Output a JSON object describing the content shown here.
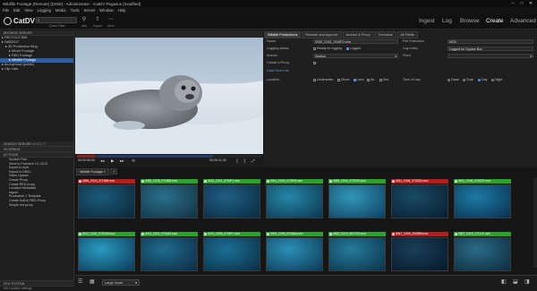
{
  "window": {
    "title": "Wildlife Footage (Remote) [D455] - Administrator - CatDV Pegasus (modified)"
  },
  "menu": [
    "File",
    "Edit",
    "View",
    "Logging",
    "Media",
    "Tools",
    "Server",
    "Window",
    "Help"
  ],
  "header": {
    "logo": "CatDV",
    "search_label": "Quick Filter",
    "toolbar": [
      {
        "icon": "filter-icon",
        "label": "Add"
      },
      {
        "icon": "export-icon",
        "label": "Export"
      },
      {
        "icon": "more-icon",
        "label": "More"
      }
    ],
    "nav": [
      "Ingest",
      "Log",
      "Browse",
      "Create",
      "Advanced"
    ],
    "active_nav": "Create"
  },
  "left": {
    "browse_header": "BROWSE SERVER",
    "tree": [
      {
        "label": "RECYCLE BIN",
        "indent": 2
      },
      {
        "label": "NAB2017",
        "indent": 2
      },
      {
        "label": "3D Production Blog",
        "indent": 6
      },
      {
        "label": "Mixed Footage",
        "indent": 10
      },
      {
        "label": "RED Footage",
        "indent": 10
      },
      {
        "label": "Wildlife Footage",
        "indent": 10,
        "selected": true
      },
      {
        "label": "Anonymous (public)",
        "indent": 2
      },
      {
        "label": "Clip Lists",
        "indent": 2
      }
    ],
    "search_header": "SEARCH SERVER",
    "search_value": "NAB2017",
    "filter_header": "FILTERING",
    "actions_header": "ACTIONS",
    "actions": [
      "Scratch Pad",
      "Send to Premiere CC 2019",
      "Export to Avid",
      "Export to DBXL",
      "Video Upload",
      "Create Proxy",
      "Create RED proxy",
      "Location Metadata",
      "Ingest",
      "Production 1 Template",
      "Create built-in RED Proxy",
      "Simple red proxy"
    ],
    "filesystem_header": "FILE SYSTEM",
    "filesystem_item": "Net Locaiton settings"
  },
  "viewer": {
    "timecode_left": "00:00:00:00",
    "timecode_right": "00:00:11:05",
    "progress": 0.1
  },
  "metadata": {
    "tabs": [
      "Wildlife Productions",
      "Release and Approve",
      "Archive & Proxy",
      "Technical",
      "All Fields"
    ],
    "active_tab": "Wildlife Productions",
    "name_label": "Name",
    "name_value": "2006_C041_0119F2.mov",
    "logging_label": "Logging status",
    "logging_opts": [
      {
        "label": "Ready for logging",
        "on": false
      },
      {
        "label": "Logged",
        "on": true
      }
    ],
    "animal_label": "Animal",
    "animal_value": "Sealion",
    "create_proxy_label": "Create a Proxy",
    "date_link": "Date/Time Info",
    "file_ext_label": "File Extension",
    "file_ext_value": "MOV",
    "log_notes_label": "Log notes",
    "log_notes_value": "Logged for Square Box",
    "plant_label": "Plant",
    "location_label": "Location",
    "location_opts": [
      {
        "label": "Underwater",
        "on": false
      },
      {
        "label": "Shore",
        "on": false
      },
      {
        "label": "Land",
        "on": true
      },
      {
        "label": "Air",
        "on": false
      },
      {
        "label": "Sea",
        "on": false
      }
    ],
    "tod_label": "Time of day",
    "tod_opts": [
      {
        "label": "Dawn",
        "on": false
      },
      {
        "label": "Dusk",
        "on": false
      },
      {
        "label": "Day",
        "on": true
      },
      {
        "label": "Night",
        "on": false
      }
    ]
  },
  "gallery": {
    "tab": "Wildlife Footage",
    "tiles": [
      {
        "name": "4056_C024_0713B5.mov",
        "status": "red",
        "c1": "#1b5a7a",
        "c2": "#0b2538"
      },
      {
        "name": "4058_C026_0713B8.mov",
        "status": "green",
        "c1": "#2a6f8a",
        "c2": "#123244"
      },
      {
        "name": "4010_C021_0720F1.mov",
        "status": "green",
        "c1": "#1f5e84",
        "c2": "#0a2a40"
      },
      {
        "name": "4041_C004_0720F8.mov",
        "status": "green",
        "c1": "#2587a8",
        "c2": "#0c3650"
      },
      {
        "name": "4058_C004_0707DE.mov",
        "status": "green",
        "c1": "#3296b8",
        "c2": "#0e4060"
      },
      {
        "name": "4011_C048_0720DD.mov",
        "status": "red",
        "c1": "#1a4a66",
        "c2": "#081e30"
      },
      {
        "name": "4011_C048_0720CE.mov",
        "status": "green",
        "c1": "#1d7aa6",
        "c2": "#093050"
      },
      {
        "name": "4011_C003_0720CB.mov",
        "status": "green",
        "c1": "#2a9ac0",
        "c2": "#0b3a58"
      },
      {
        "name": "4013_C002_0716A2.mov",
        "status": "green",
        "c1": "#1f6a8e",
        "c2": "#0c2c42"
      },
      {
        "name": "4014_C005_0718F1.mov",
        "status": "green",
        "c1": "#1b6f96",
        "c2": "#0a2e44"
      },
      {
        "name": "4004_C006_0715AA.mov",
        "status": "green",
        "c1": "#2b8fb6",
        "c2": "#0e3a56"
      },
      {
        "name": "4005_C019_0617CE.mov",
        "status": "green",
        "c1": "#257a9c",
        "c2": "#0b3248"
      },
      {
        "name": "0367_C009_2002BB.mov",
        "status": "red",
        "c1": "#1a3e58",
        "c2": "#081828"
      },
      {
        "name": "0367_C019_1711JC.mov",
        "status": "green",
        "c1": "#2a6a86",
        "c2": "#0d2c3c"
      }
    ]
  },
  "footer": {
    "view_size": "Large Icons"
  }
}
